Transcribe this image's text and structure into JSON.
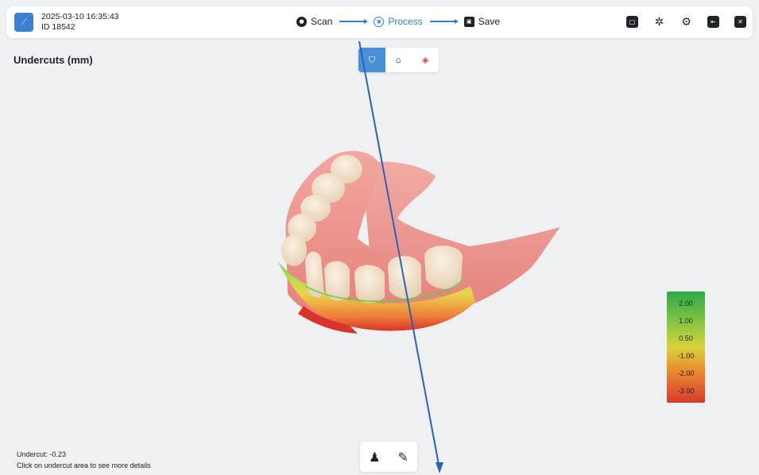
{
  "header": {
    "datetime": "2025-03-10 16:35:43",
    "id": "ID 18542",
    "steps": [
      {
        "label": "Scan",
        "icon": "scan-icon",
        "active": false
      },
      {
        "label": "Process",
        "icon": "process-icon",
        "active": true
      },
      {
        "label": "Save",
        "icon": "save-icon",
        "active": false
      }
    ],
    "tools": [
      "screen-icon",
      "pattern-icon",
      "settings-icon",
      "exit-icon",
      "close-icon"
    ]
  },
  "view": {
    "title": "Undercuts (mm)",
    "modes": [
      {
        "icon": "tooth-lock-icon",
        "active": true
      },
      {
        "icon": "tooth-outline-icon",
        "active": false
      },
      {
        "icon": "drop-icon",
        "active": false
      }
    ]
  },
  "legend": {
    "values": [
      "2.00",
      "1.00",
      "0.50",
      "-1.00",
      "-2.00",
      "-3.00"
    ],
    "colors": [
      "#2fa84a",
      "#7cc443",
      "#d9d33b",
      "#e98a2f",
      "#d83a2c"
    ]
  },
  "status": {
    "undercut": "Undercut: -0.23",
    "hint": "Click on undercut area to see more details"
  },
  "bottom_tools": [
    "person-icon",
    "pencil-icon"
  ],
  "colors": {
    "accent": "#2f7fd8",
    "axis": "#2a62b8"
  }
}
